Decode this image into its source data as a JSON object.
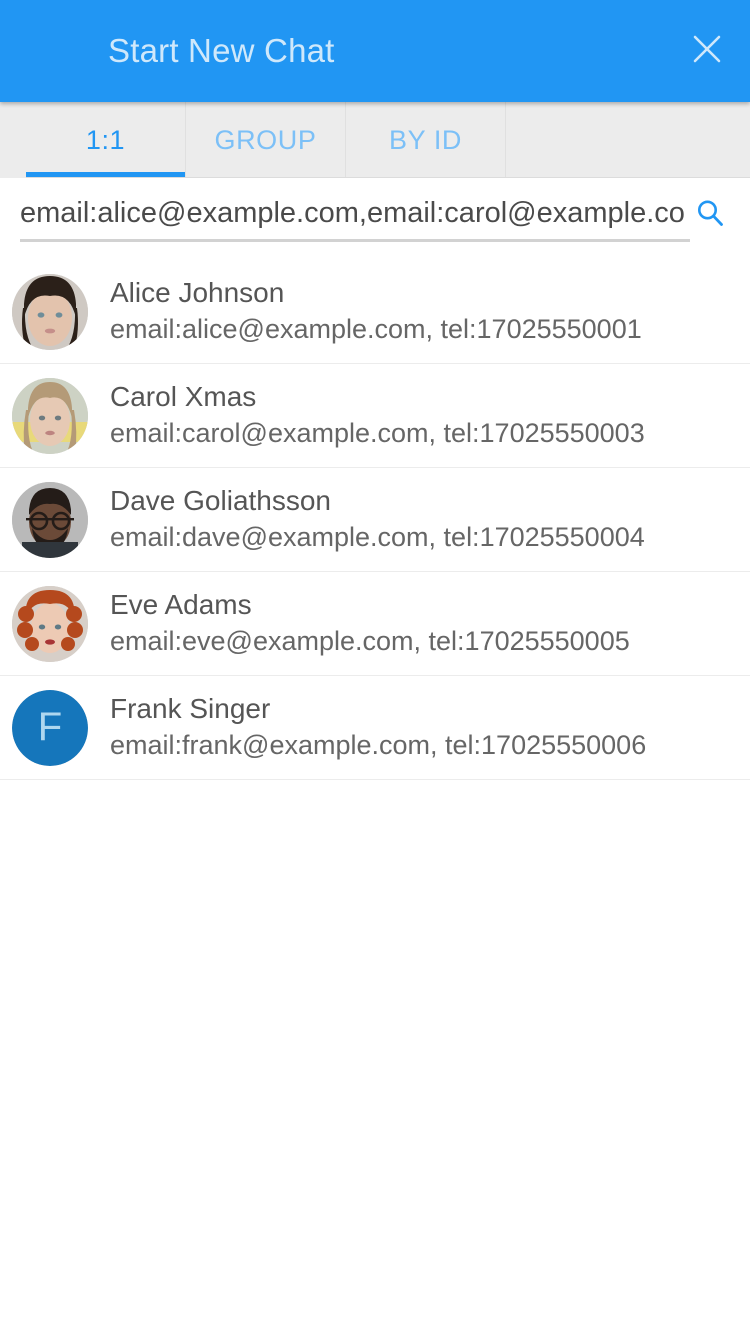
{
  "header": {
    "title": "Start New Chat",
    "close_icon": "close-icon",
    "bg_color": "#2196f3",
    "title_color": "#cfe8fb"
  },
  "tabs": {
    "active_index": 0,
    "items": [
      {
        "label": "1:1"
      },
      {
        "label": "GROUP"
      },
      {
        "label": "BY ID"
      }
    ],
    "active_color": "#2196f3",
    "inactive_color": "#7cc0f7",
    "bar_bg": "#ececec"
  },
  "search": {
    "value": "email:alice@example.com,email:carol@example.co",
    "placeholder": "Search",
    "icon": "search-icon",
    "icon_color": "#2196f3"
  },
  "contacts": [
    {
      "name": "Alice Johnson",
      "detail": "email:alice@example.com, tel:17025550001",
      "avatar_type": "photo",
      "avatar_skin": "#e3c3ad",
      "avatar_hair": "#2b2019",
      "avatar_bg": "#d8d2cc"
    },
    {
      "name": "Carol Xmas",
      "detail": "email:carol@example.com, tel:17025550003",
      "avatar_type": "photo",
      "avatar_skin": "#e6c9b4",
      "avatar_hair": "#b49a77",
      "avatar_bg": "#d9cfae"
    },
    {
      "name": "Dave Goliathsson",
      "detail": "email:dave@example.com, tel:17025550004",
      "avatar_type": "photo",
      "avatar_skin": "#6b4a38",
      "avatar_hair": "#241c18",
      "avatar_bg": "#b9b9b9"
    },
    {
      "name": "Eve Adams",
      "detail": "email:eve@example.com, tel:17025550005",
      "avatar_type": "photo",
      "avatar_skin": "#edcab4",
      "avatar_hair": "#b5491d",
      "avatar_bg": "#d7cfc8"
    },
    {
      "name": "Frank Singer",
      "detail": "email:frank@example.com, tel:17025550006",
      "avatar_type": "initial",
      "avatar_initial": "F",
      "avatar_bg": "#1576bb",
      "avatar_fg": "#aed7ef"
    }
  ]
}
